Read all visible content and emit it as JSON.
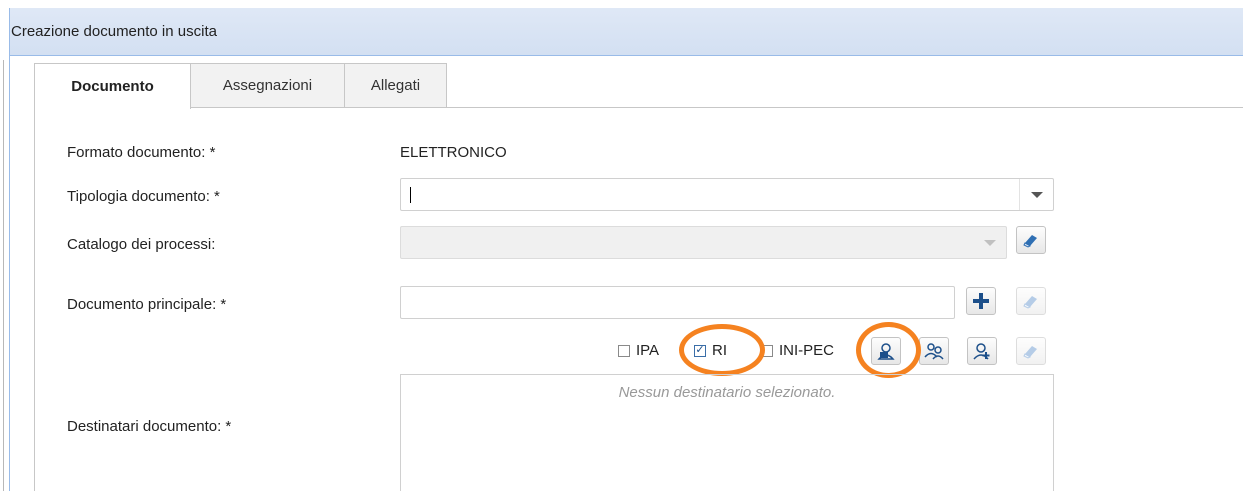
{
  "panel": {
    "title": "Creazione documento in uscita"
  },
  "tabs": [
    "Documento",
    "Assegnazioni",
    "Allegati"
  ],
  "form": {
    "formato": {
      "label": "Formato documento: *",
      "value": "ELETTRONICO"
    },
    "tipologia": {
      "label": "Tipologia documento: *",
      "value": ""
    },
    "catalogo": {
      "label": "Catalogo dei processi:",
      "value": ""
    },
    "principale": {
      "label": "Documento principale: *",
      "value": ""
    },
    "destinatari": {
      "label": "Destinatari documento: *",
      "empty_text": "Nessun destinatario selezionato."
    }
  },
  "recipient_sources": [
    {
      "label": "IPA",
      "checked": false
    },
    {
      "label": "RI",
      "checked": true
    },
    {
      "label": "INI-PEC",
      "checked": false
    }
  ],
  "icons": {
    "catalog_clear": "eraser-icon",
    "add": "plus-icon",
    "principale_clear": "eraser-icon",
    "search_recipient": "search-person-icon",
    "select_recipients": "people-icon",
    "add_recipient": "add-person-icon",
    "recipients_clear": "eraser-icon"
  },
  "colors": {
    "header_bg": "#dfe8f6",
    "accent_blue": "#1c4f8a",
    "highlight": "#f58220"
  }
}
